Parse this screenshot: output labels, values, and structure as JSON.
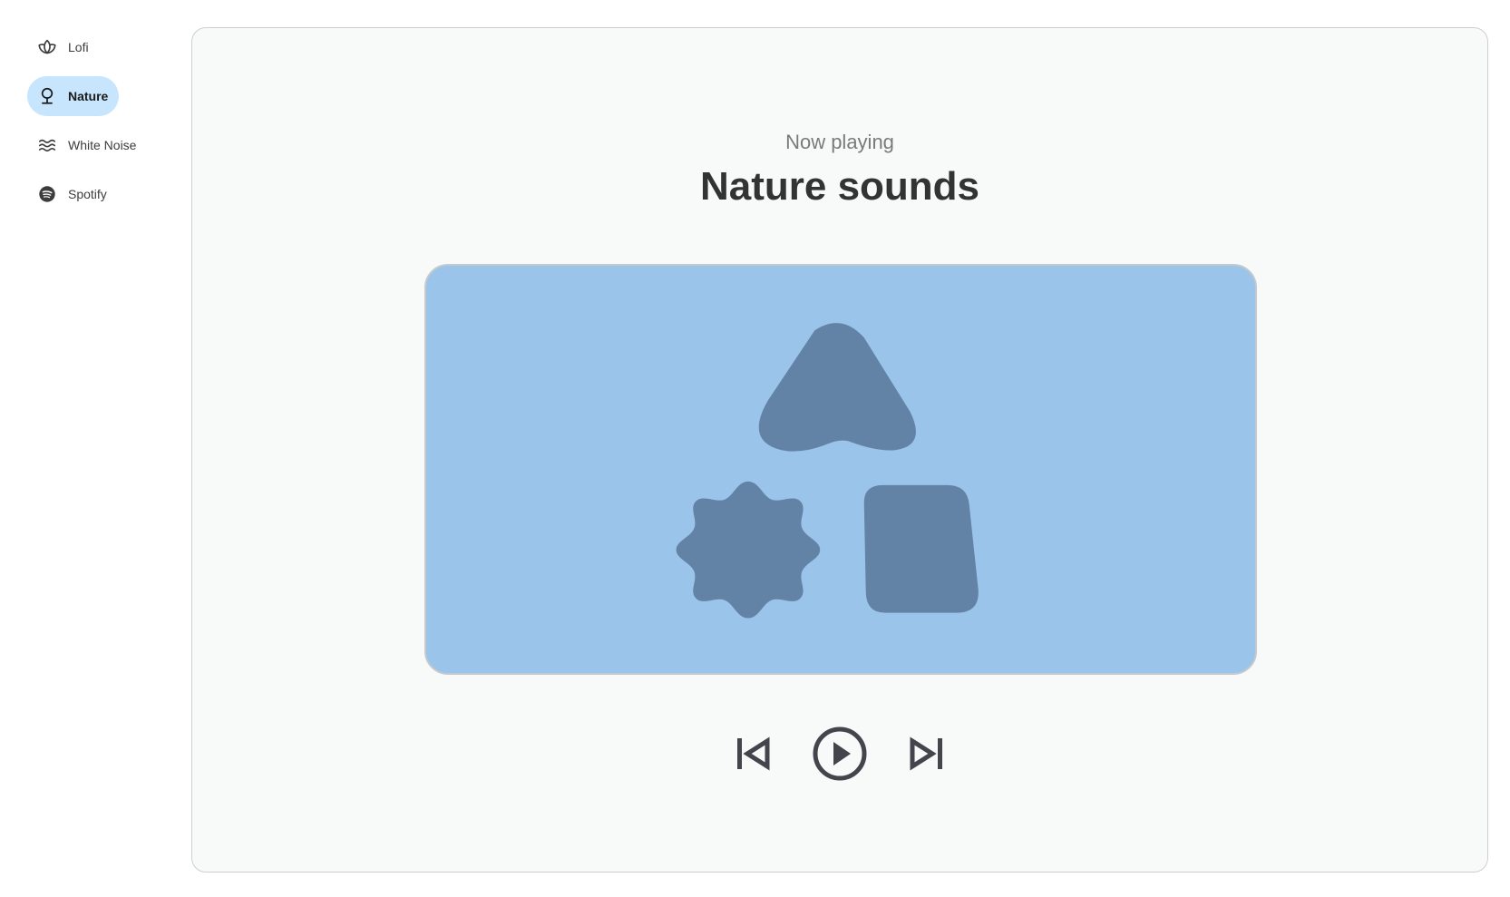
{
  "sidebar": {
    "items": [
      {
        "label": "Lofi",
        "icon": "lotus-icon",
        "active": false
      },
      {
        "label": "Nature",
        "icon": "tree-icon",
        "active": true
      },
      {
        "label": "White Noise",
        "icon": "waves-icon",
        "active": false
      },
      {
        "label": "Spotify",
        "icon": "spotify-icon",
        "active": false
      }
    ]
  },
  "player": {
    "now_playing_label": "Now playing",
    "track_title": "Nature sounds",
    "artwork_icon": "shapes-placeholder-icon",
    "controls": {
      "previous_icon": "skip-previous-icon",
      "play_icon": "play-circle-icon",
      "next_icon": "skip-next-icon"
    }
  },
  "colors": {
    "active_nav_bg": "#c7e5fc",
    "artwork_bg": "#9bc4eb",
    "artwork_shapes": "#6282a6",
    "control_icon": "#44444c",
    "card_bg": "#f8f9f9"
  }
}
